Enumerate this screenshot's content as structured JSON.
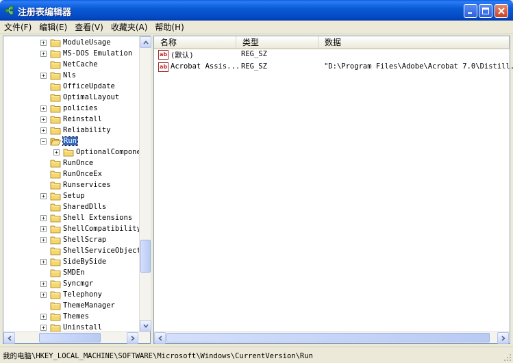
{
  "window": {
    "title": "注册表编辑器",
    "icon": "registry-editor-icon"
  },
  "menu": [
    {
      "label": "文件(F)"
    },
    {
      "label": "编辑(E)"
    },
    {
      "label": "查看(V)"
    },
    {
      "label": "收藏夹(A)"
    },
    {
      "label": "帮助(H)"
    }
  ],
  "tree": {
    "items": [
      {
        "label": "ModuleUsage",
        "expander": "+",
        "level": 0
      },
      {
        "label": "MS-DOS Emulation",
        "expander": "+",
        "level": 0
      },
      {
        "label": "NetCache",
        "expander": "",
        "level": 0
      },
      {
        "label": "Nls",
        "expander": "+",
        "level": 0
      },
      {
        "label": "OfficeUpdate",
        "expander": "",
        "level": 0
      },
      {
        "label": "OptimalLayout",
        "expander": "",
        "level": 0
      },
      {
        "label": "policies",
        "expander": "+",
        "level": 0
      },
      {
        "label": "Reinstall",
        "expander": "+",
        "level": 0
      },
      {
        "label": "Reliability",
        "expander": "+",
        "level": 0
      },
      {
        "label": "Run",
        "expander": "-",
        "level": 0,
        "selected": true,
        "open": true
      },
      {
        "label": "OptionalCompone",
        "expander": "+",
        "level": 1
      },
      {
        "label": "RunOnce",
        "expander": "",
        "level": 0
      },
      {
        "label": "RunOnceEx",
        "expander": "",
        "level": 0
      },
      {
        "label": "Runservices",
        "expander": "",
        "level": 0
      },
      {
        "label": "Setup",
        "expander": "+",
        "level": 0
      },
      {
        "label": "SharedDlls",
        "expander": "",
        "level": 0
      },
      {
        "label": "Shell Extensions",
        "expander": "+",
        "level": 0
      },
      {
        "label": "ShellCompatibility",
        "expander": "+",
        "level": 0
      },
      {
        "label": "ShellScrap",
        "expander": "+",
        "level": 0
      },
      {
        "label": "ShellServiceObject",
        "expander": "",
        "level": 0
      },
      {
        "label": "SideBySide",
        "expander": "+",
        "level": 0
      },
      {
        "label": "SMDEn",
        "expander": "",
        "level": 0
      },
      {
        "label": "Syncmgr",
        "expander": "+",
        "level": 0
      },
      {
        "label": "Telephony",
        "expander": "+",
        "level": 0
      },
      {
        "label": "ThemeManager",
        "expander": "",
        "level": 0
      },
      {
        "label": "Themes",
        "expander": "+",
        "level": 0
      },
      {
        "label": "Uninstall",
        "expander": "+",
        "level": 0
      }
    ]
  },
  "list": {
    "columns": [
      {
        "label": "名称"
      },
      {
        "label": "类型"
      },
      {
        "label": "数据"
      }
    ],
    "rows": [
      {
        "name": "(默认)",
        "type": "REG_SZ",
        "data": "",
        "icon": "string-value-icon"
      },
      {
        "name": "Acrobat Assis...",
        "type": "REG_SZ",
        "data": "\"D:\\Program Files\\Adobe\\Acrobat 7.0\\Distill...",
        "icon": "string-value-icon"
      }
    ]
  },
  "status": {
    "path": "我的电脑\\HKEY_LOCAL_MACHINE\\SOFTWARE\\Microsoft\\Windows\\CurrentVersion\\Run"
  },
  "colors": {
    "titlebar": "#0A5BD6",
    "selection": "#316AC5",
    "folder": "#F5D76E"
  }
}
